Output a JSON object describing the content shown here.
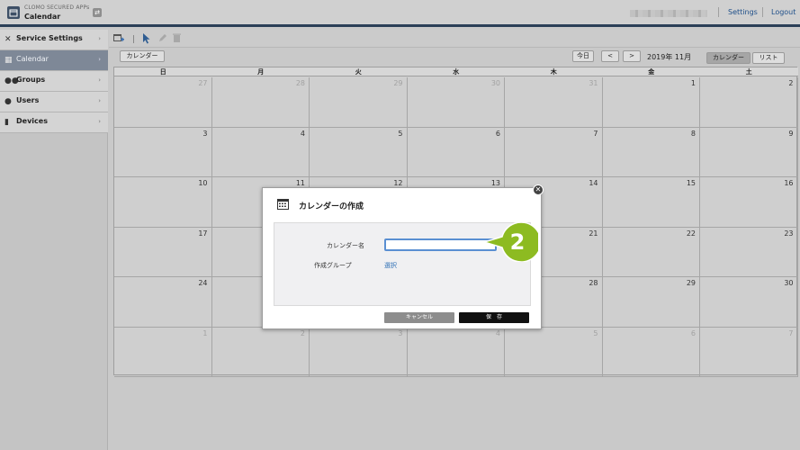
{
  "app": {
    "brand": "CLOMO SECURED APPs",
    "title": "Calendar"
  },
  "header": {
    "settings_label": "Settings",
    "logout_label": "Logout"
  },
  "sidebar": {
    "items": [
      {
        "label": "Service Settings",
        "icon": "wrench-icon"
      },
      {
        "label": "Calendar",
        "icon": "calendar-icon",
        "active": true
      },
      {
        "label": "Groups",
        "icon": "group-icon"
      },
      {
        "label": "Users",
        "icon": "user-icon"
      },
      {
        "label": "Devices",
        "icon": "device-icon"
      }
    ]
  },
  "subbar": {
    "calendar_button": "カレンダー",
    "today_button": "今日",
    "prev_button": "<",
    "next_button": ">",
    "month": "2019年 11月",
    "view_calendar": "カレンダー",
    "view_list": "リスト"
  },
  "calendar": {
    "weekdays": [
      "日",
      "月",
      "火",
      "水",
      "木",
      "金",
      "土"
    ],
    "weeks": [
      [
        "27",
        "28",
        "29",
        "30",
        "31",
        "1",
        "2"
      ],
      [
        "3",
        "4",
        "5",
        "6",
        "7",
        "8",
        "9"
      ],
      [
        "10",
        "11",
        "12",
        "13",
        "14",
        "15",
        "16"
      ],
      [
        "17",
        "",
        "",
        "",
        "21",
        "22",
        "23"
      ],
      [
        "24",
        "",
        "",
        "",
        "28",
        "29",
        "30"
      ],
      [
        "1",
        "2",
        "3",
        "4",
        "5",
        "6",
        "7"
      ]
    ]
  },
  "modal": {
    "title": "カレンダーの作成",
    "name_label": "カレンダー名",
    "name_value": "",
    "group_label": "作成グループ",
    "group_select": "選択",
    "cancel_label": "キャンセル",
    "save_label": "保　存"
  },
  "callout": {
    "step": "2",
    "color": "#8dbb21"
  }
}
